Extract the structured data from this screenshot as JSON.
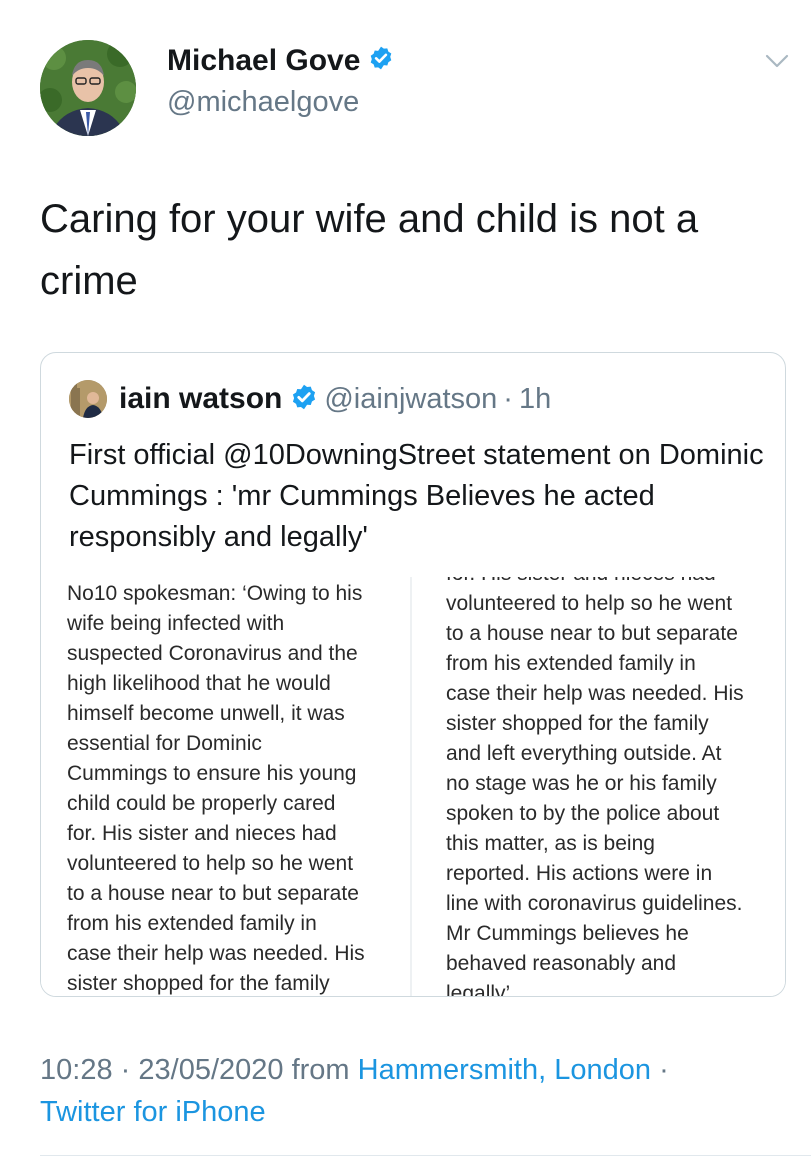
{
  "tweet": {
    "author_name": "Michael Gove",
    "author_handle": "@michaelgove",
    "text": "Caring for your wife and child is not a crime",
    "time": "10:28",
    "separator": "·",
    "date": "23/05/2020",
    "from_label": "from",
    "location": "Hammersmith, London",
    "source": "Twitter for iPhone"
  },
  "quoted": {
    "author_name": "iain watson",
    "author_handle": "@iainjwatson",
    "separator": "·",
    "age": "1h",
    "text": "First official @10DowningStreet statement on Dominic Cummings : 'mr Cummings Believes he acted responsibly and legally'",
    "image_left_lines": [
      "No10 spokesman: ‘Owing to his",
      "wife being infected with",
      "suspected Coronavirus and the",
      "high likelihood that he would",
      "himself become unwell, it was",
      "essential for Dominic",
      "Cummings to ensure his young",
      "child could be properly cared",
      "for. His sister and nieces had",
      "volunteered to help so he went",
      "to a house near to but separate",
      "from his extended family in",
      "case their help was needed. His",
      "sister shopped for the family"
    ],
    "image_right_lines": [
      "for. His sister and nieces had",
      "volunteered to help so he went",
      "to a house near to but separate",
      "from his extended family in",
      "case their help was needed. His",
      "sister shopped for the family",
      "and left everything outside. At",
      "no stage was he or his family",
      "spoken to by the police about",
      "this matter, as is being",
      "reported. His actions were in",
      "line with coronavirus guidelines.",
      "Mr Cummings believes he",
      "behaved reasonably and",
      "legally’"
    ]
  },
  "colors": {
    "verified": "#1da1f2",
    "link": "#1b95e0",
    "muted": "#657786"
  },
  "icons": {
    "verified": "verified-badge-icon",
    "menu": "chevron-down-icon"
  }
}
